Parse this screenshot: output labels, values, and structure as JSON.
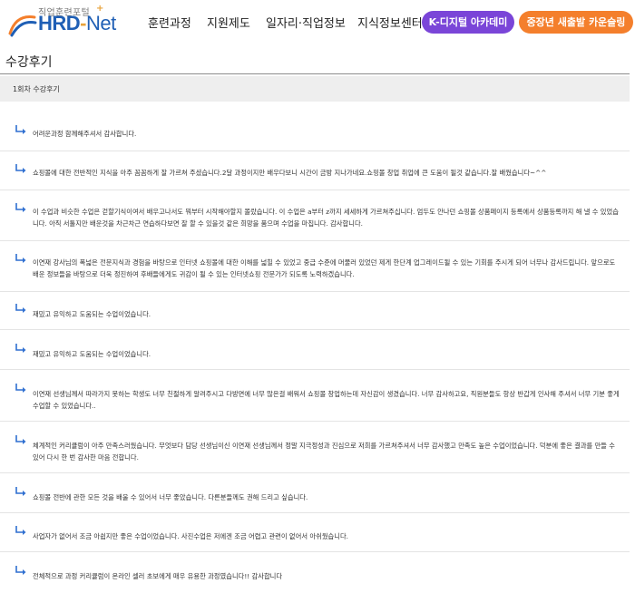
{
  "header": {
    "logo_sub": "직업훈련포털",
    "logo_plus": "+",
    "logo_main_a": "HRD",
    "logo_main_dash": "-",
    "logo_main_b": "Net",
    "nav": [
      "훈련과정",
      "지원제도",
      "일자리·직업정보",
      "지식정보센터"
    ],
    "pill_k": "K-디지털 아카데미",
    "pill_c": "중장년 새출발 카운슬링",
    "colors": {
      "brand": "#1f5fb5",
      "accent_orange": "#f47f2c",
      "accent_purple": "#7a45d8"
    }
  },
  "page": {
    "title": "수강후기",
    "section_label": "1회차 수강후기"
  },
  "reviews": [
    {
      "text": "어려운과정 함께해주셔서 감사합니다."
    },
    {
      "text": "쇼핑몰에 대한 전반적인 지식을 아주 꼼꼼하게 잘 가르쳐 주셨습니다.2달 과정이지만 배우다보니 시간이 금방 지나가네요.쇼핑몰 창업 취업에 큰 도움이 될것 같습니다.잘 배웠습니다~^^"
    },
    {
      "text": "이 수업과 비슷한 수업은 걷할기식이여서 배우고나서도 뭐부터 시작해야할지 몰랐습니다. 이 수업은 a부터 z까지 세세하게 가르쳐주십니다. 엄두도 안나던 쇼핑몰 상품페이지 등록에서 상품등록까지 해 낼 수 있었습니다. 아직 서툴지만 배운것을 차근차근 연습하다보면 잘 할 수 있을것 같은 희망을 품으며 수업을 마칩니다. 감사합니다."
    },
    {
      "text": "이연재 강사님의 폭넓은 전문지식과 경험을 바탕으로 인터넷 쇼핑몰에 대한 이해를 넓힐 수 있었고 중급 수준에 머물러 있었던 제게 한단계 업그레이드될 수 있는 기회를 주시게 되어 너무나 감사드립니다. 앞으로도 배운 정보들을 바탕으로 더욱 정진하여 후배들에게도 귀감이 될 수 있는 인터넷쇼핑 전문가가 되도록 노력하겠습니다."
    },
    {
      "text": "재밌고 유익하고 도움되는 수업이었습니다."
    },
    {
      "text": "재밌고 유익하고 도움되는 수업이었습니다."
    },
    {
      "text": "이연재 선생님께서 따라가지 못하는 학생도 너무 친절하게 알려주시고 다방면에 너무 많은걸 배워서 쇼핑몰 창업하는데 자신감이 생겼습니다. 너무 감사하고요, 직원분들도 항상 반갑게 인사해 주셔서 너무 기분 좋게 수업할 수 있었습니다.."
    },
    {
      "text": "체계적인 커리큘럼이 아주 만족스러웠습니다. 무엇보다 담당 선생님이신 이연재 선생님께서 정말 지극정성과 진심으로 저희를 가르쳐주셔서 너무 감사했고 만족도 높은 수업이었습니다. 덕분에 좋은 결과를 만들 수 있어 다시 한 번 감사한 마음 전합니다."
    },
    {
      "text": "쇼핑몰 전반에 관한 모든 것을 배울 수 있어서 너무 좋았습니다. 다른분들께도 권해 드리고 싶습니다."
    },
    {
      "text": "사업자가 없어서 조금 아쉽지만 좋은 수업이었습니다. 사진수업은 저에겐 조금 어렵고 관련이 없어서 아쉬웠습니다."
    },
    {
      "text": "전체적으로 과정 커리큘럼이 온라인 셀러 초보에게 매우 유용한 과정였습니다!! 감사합니다"
    }
  ]
}
